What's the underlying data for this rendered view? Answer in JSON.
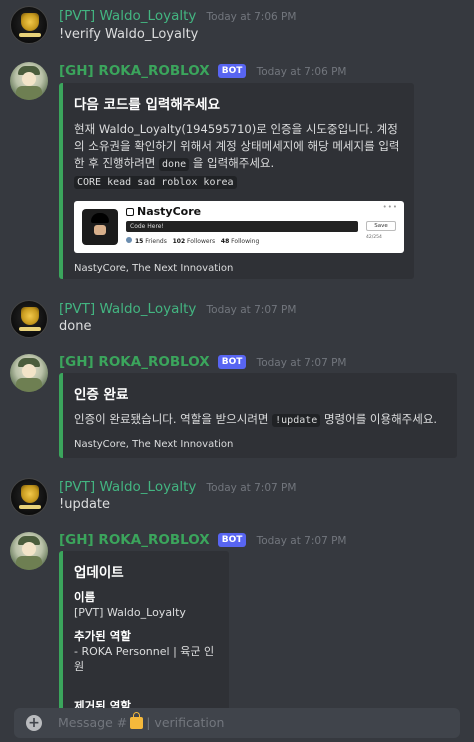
{
  "messages": {
    "m1": {
      "author": "[PVT] Waldo_Loyalty",
      "timestamp": "Today at 7:06 PM",
      "text": "!verify Waldo_Loyalty"
    },
    "m2": {
      "author": "[GH] ROKA_ROBLOX",
      "bot_tag": "BOT",
      "timestamp": "Today at 7:06 PM",
      "embed": {
        "title": "다음 코드를 입력해주세요",
        "desc_part1": "현재 Waldo_Loyalty(194595710)로 인증을 시도중입니다. 계정의 소유권을 확인하기 위해서 계정 상태메세지에 해당 메세지를 입력한 후 진행하려면",
        "desc_code": "done",
        "desc_part2": "을 입력해주세요.",
        "code_block": "CORE kead sad roblox korea",
        "image": {
          "profile_name": "NastyCore",
          "input_text": "Code Here!",
          "save_label": "Save",
          "friends_count": "15",
          "friends_label": "Friends",
          "followers_count": "102",
          "followers_label": "Followers",
          "following_count": "48",
          "following_label": "Following",
          "corner_text": "42/254"
        },
        "footer": "NastyCore, The Next Innovation"
      }
    },
    "m3": {
      "author": "[PVT] Waldo_Loyalty",
      "timestamp": "Today at 7:07 PM",
      "text": "done"
    },
    "m4": {
      "author": "[GH] ROKA_ROBLOX",
      "bot_tag": "BOT",
      "timestamp": "Today at 7:07 PM",
      "embed": {
        "title": "인증 완료",
        "desc_part1": "인증이 완료됐습니다. 역할을 받으시려면",
        "desc_code": "!update",
        "desc_part2": "명령어를 이용해주세요.",
        "footer": "NastyCore, The Next Innovation"
      }
    },
    "m5": {
      "author": "[PVT] Waldo_Loyalty",
      "timestamp": "Today at 7:07 PM",
      "text": "!update"
    },
    "m6": {
      "author": "[GH] ROKA_ROBLOX",
      "bot_tag": "BOT",
      "timestamp": "Today at 7:07 PM",
      "embed": {
        "title": "업데이트",
        "field1_name": "이름",
        "field1_value": "[PVT] Waldo_Loyalty",
        "field2_name": "추가된 역할",
        "field2_value": "- ROKA Personnel | 육군 인원",
        "field3_name": "제거된 역할"
      }
    }
  },
  "composer": {
    "placeholder_prefix": "Message #",
    "channel": "| verification"
  },
  "colors": {
    "background": "#36393f",
    "embed_bg": "#2f3136",
    "embed_accent": "#3ba55c",
    "username": "#43b581",
    "bot_tag": "#5865f2"
  }
}
